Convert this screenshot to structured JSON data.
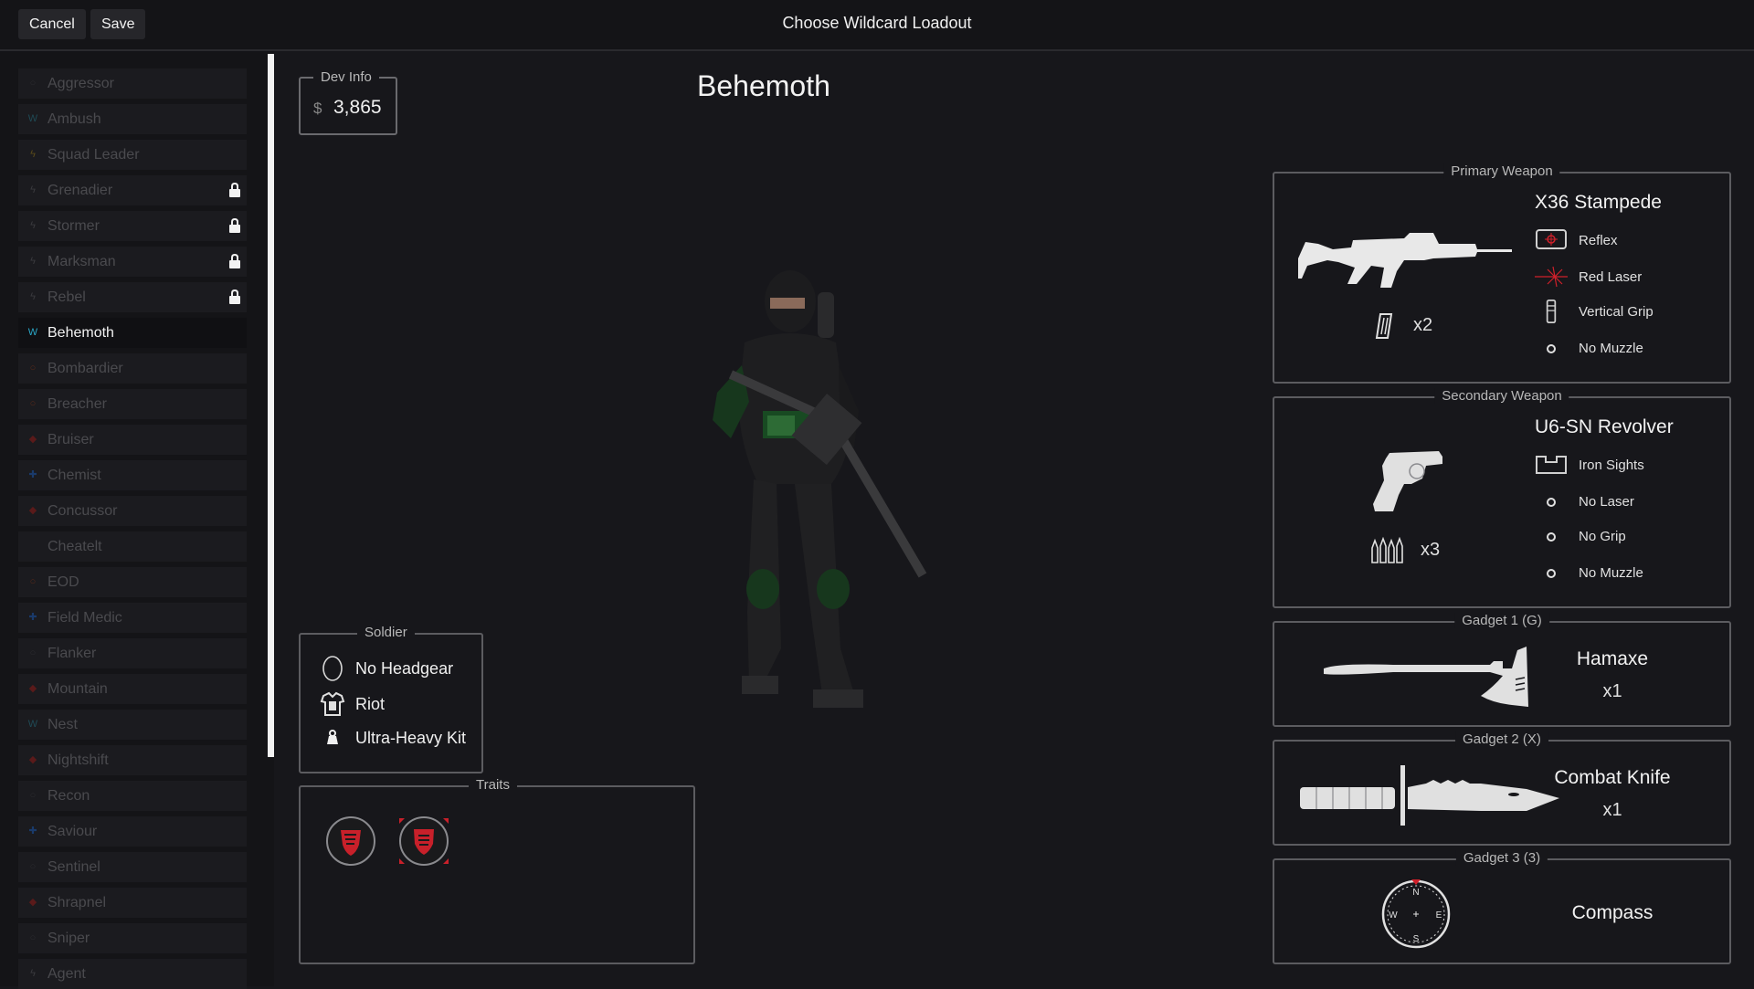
{
  "header": {
    "cancel_label": "Cancel",
    "save_label": "Save",
    "title": "Choose Wildcard Loadout"
  },
  "sidebar": {
    "items": [
      {
        "label": "Aggressor",
        "icon": "ring-icon",
        "color": "#2c2c30",
        "locked": false,
        "active": false
      },
      {
        "label": "Ambush",
        "icon": "claw-icon",
        "color": "#1f4a55",
        "locked": false,
        "active": false
      },
      {
        "label": "Squad Leader",
        "icon": "bolt-icon",
        "color": "#5a4a1a",
        "locked": false,
        "active": false
      },
      {
        "label": "Grenadier",
        "icon": "bolt-icon",
        "color": "#3a3a3e",
        "locked": true,
        "active": false
      },
      {
        "label": "Stormer",
        "icon": "bolt-icon",
        "color": "#3a3a3e",
        "locked": true,
        "active": false
      },
      {
        "label": "Marksman",
        "icon": "bolt-icon",
        "color": "#3a3a3e",
        "locked": true,
        "active": false
      },
      {
        "label": "Rebel",
        "icon": "bolt-icon",
        "color": "#3a3a3e",
        "locked": true,
        "active": false
      },
      {
        "label": "Behemoth",
        "icon": "claw-icon",
        "color": "#2aa8c8",
        "locked": false,
        "active": true
      },
      {
        "label": "Bombardier",
        "icon": "ring-icon",
        "color": "#5a2a1a",
        "locked": false,
        "active": false
      },
      {
        "label": "Breacher",
        "icon": "ring-icon",
        "color": "#5a2a1a",
        "locked": false,
        "active": false
      },
      {
        "label": "Bruiser",
        "icon": "shield-icon",
        "color": "#5a1a1a",
        "locked": false,
        "active": false
      },
      {
        "label": "Chemist",
        "icon": "cross-icon",
        "color": "#1a3a6a",
        "locked": false,
        "active": false
      },
      {
        "label": "Concussor",
        "icon": "shield-icon",
        "color": "#5a1a1a",
        "locked": false,
        "active": false
      },
      {
        "label": "Cheatelt",
        "icon": "none",
        "color": "#1b1b1f",
        "locked": false,
        "active": false
      },
      {
        "label": "EOD",
        "icon": "ring-icon",
        "color": "#5a2a1a",
        "locked": false,
        "active": false
      },
      {
        "label": "Field Medic",
        "icon": "cross-icon",
        "color": "#1a3a6a",
        "locked": false,
        "active": false
      },
      {
        "label": "Flanker",
        "icon": "ring-icon",
        "color": "#2c2c30",
        "locked": false,
        "active": false
      },
      {
        "label": "Mountain",
        "icon": "shield-icon",
        "color": "#5a1a1a",
        "locked": false,
        "active": false
      },
      {
        "label": "Nest",
        "icon": "claw-icon",
        "color": "#1f4a55",
        "locked": false,
        "active": false
      },
      {
        "label": "Nightshift",
        "icon": "shield-icon",
        "color": "#5a1a1a",
        "locked": false,
        "active": false
      },
      {
        "label": "Recon",
        "icon": "ring-icon",
        "color": "#2c2c30",
        "locked": false,
        "active": false
      },
      {
        "label": "Saviour",
        "icon": "cross-icon",
        "color": "#1a3a6a",
        "locked": false,
        "active": false
      },
      {
        "label": "Sentinel",
        "icon": "ring-icon",
        "color": "#2c2c30",
        "locked": false,
        "active": false
      },
      {
        "label": "Shrapnel",
        "icon": "shield-icon",
        "color": "#5a1a1a",
        "locked": false,
        "active": false
      },
      {
        "label": "Sniper",
        "icon": "ring-icon",
        "color": "#2c2c30",
        "locked": false,
        "active": false
      },
      {
        "label": "Agent",
        "icon": "bolt-icon",
        "color": "#3a3a3e",
        "locked": false,
        "active": false
      }
    ]
  },
  "dev_info": {
    "legend": "Dev Info",
    "currency": "$",
    "value": "3,865"
  },
  "loadout_name": "Behemoth",
  "soldier": {
    "legend": "Soldier",
    "headgear": "No Headgear",
    "armor": "Riot",
    "kit": "Ultra-Heavy Kit"
  },
  "traits": {
    "legend": "Traits"
  },
  "primary": {
    "legend": "Primary Weapon",
    "name": "X36 Stampede",
    "mags": "x2",
    "attachments": [
      {
        "label": "Reflex",
        "icon": "reflex-sight-icon"
      },
      {
        "label": "Red Laser",
        "icon": "red-laser-icon"
      },
      {
        "label": "Vertical Grip",
        "icon": "vertical-grip-icon"
      },
      {
        "label": "No Muzzle",
        "icon": "empty-slot-icon"
      }
    ]
  },
  "secondary": {
    "legend": "Secondary Weapon",
    "name": "U6-SN Revolver",
    "mags": "x3",
    "attachments": [
      {
        "label": "Iron Sights",
        "icon": "iron-sights-icon"
      },
      {
        "label": "No Laser",
        "icon": "empty-slot-icon"
      },
      {
        "label": "No Grip",
        "icon": "empty-slot-icon"
      },
      {
        "label": "No Muzzle",
        "icon": "empty-slot-icon"
      }
    ]
  },
  "gadget1": {
    "legend": "Gadget 1 (G)",
    "name": "Hamaxe",
    "count": "x1"
  },
  "gadget2": {
    "legend": "Gadget 2 (X)",
    "name": "Combat Knife",
    "count": "x1"
  },
  "gadget3": {
    "legend": "Gadget 3 (3)",
    "name": "Compass"
  },
  "colors": {
    "accent": "#2aa8c8",
    "trait_red": "#c8202a",
    "laser_red": "#d0202a"
  }
}
